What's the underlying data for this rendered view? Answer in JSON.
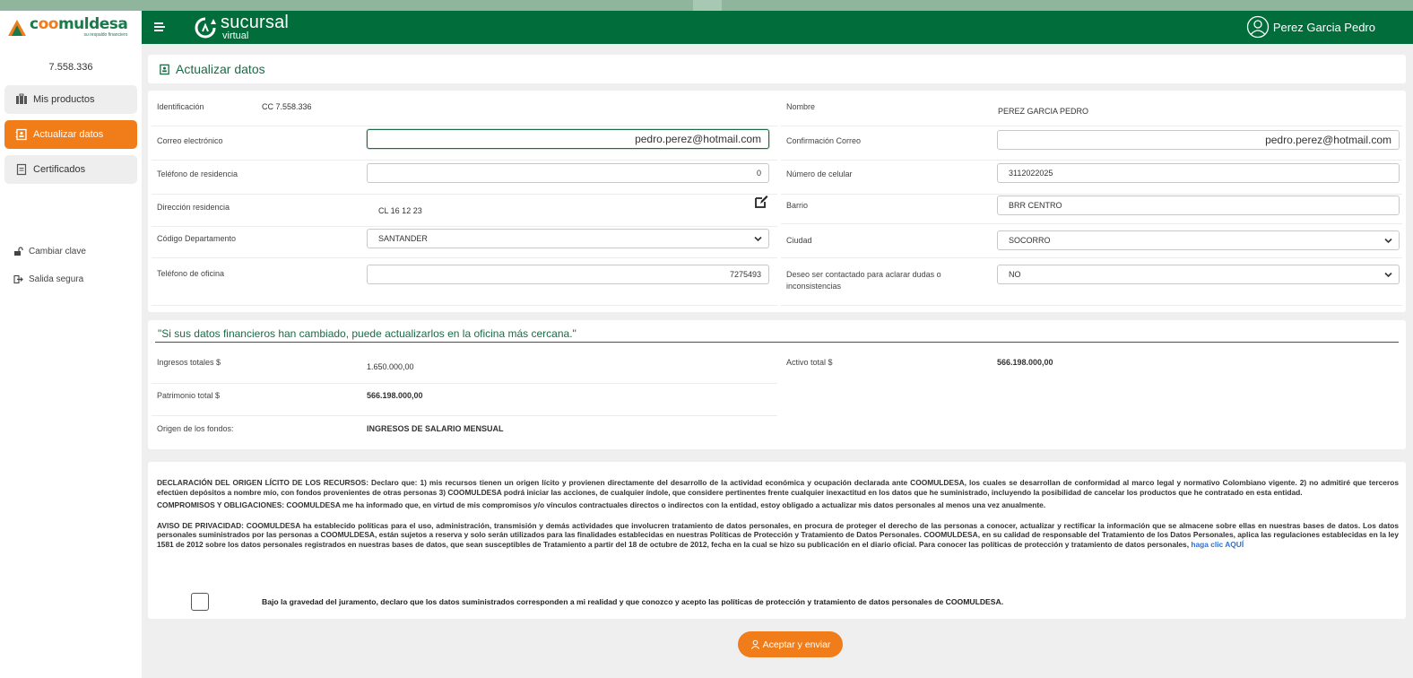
{
  "app": {
    "logo_name_a": "c",
    "logo_name_o": "oo",
    "logo_name_b": "muldesa",
    "logo_tagline": "su respaldo financiero",
    "brand_main": "sucursal",
    "brand_sub": "virtual",
    "user_name": "Perez Garcia Pedro"
  },
  "sidebar": {
    "id_number": "7.558.336",
    "items": [
      {
        "label": "Mis productos",
        "icon": "briefcase-icon"
      },
      {
        "label": "Actualizar datos",
        "icon": "contact-card-icon"
      },
      {
        "label": "Certificados",
        "icon": "document-icon"
      }
    ],
    "links": [
      {
        "label": "Cambiar clave",
        "icon": "unlock-icon"
      },
      {
        "label": "Salida segura",
        "icon": "logout-icon"
      }
    ]
  },
  "page": {
    "title": "Actualizar datos"
  },
  "form": {
    "identificacion_label": "Identificación",
    "identificacion_value": "CC 7.558.336",
    "nombre_label": "Nombre",
    "nombre_value": "PEREZ GARCIA PEDRO",
    "correo_label": "Correo electrónico",
    "correo_value": "pedro.perez@hotmail.com",
    "confirm_correo_label": "Confirmación Correo",
    "confirm_correo_value": "pedro.perez@hotmail.com",
    "tel_residencia_label": "Teléfono de residencia",
    "tel_residencia_value": "0",
    "celular_label": "Número de celular",
    "celular_value": "3112022025",
    "direccion_label": "Dirección residencia",
    "direccion_value": "CL 16 12 23",
    "barrio_label": "Barrio",
    "barrio_value": "BRR CENTRO",
    "departamento_label": "Código Departamento",
    "departamento_value": "SANTANDER",
    "ciudad_label": "Ciudad",
    "ciudad_value": "SOCORRO",
    "tel_oficina_label": "Teléfono de oficina",
    "tel_oficina_value": "7275493",
    "contacto_label_1": "Deseo ser contactado para aclarar dudas o",
    "contacto_label_2": "inconsistencias",
    "contacto_value": "NO"
  },
  "financial": {
    "quote": "\"Si sus datos financieros han cambiado, puede actualizarlos en la oficina más cercana.\"",
    "ingresos_label": "Ingresos totales $",
    "ingresos_value": "1.650.000,00",
    "activo_label": "Activo total $",
    "activo_value": "566.198.000,00",
    "patrimonio_label": "Patrimonio total $",
    "patrimonio_value": "566.198.000,00",
    "origen_label": "Origen de los fondos:",
    "origen_value": "INGRESOS DE SALARIO MENSUAL"
  },
  "declaration": {
    "p1_title": "DECLARACIÓN DEL ORIGEN LÍCITO DE LOS RECURSOS:",
    "p1_body": " Declaro que: 1) mis recursos tienen un origen lícito y provienen directamente del desarrollo de la actividad económica y ocupación declarada ante COOMULDESA, los cuales se desarrollan de conformidad al marco legal y normativo Colombiano vigente. 2) no admitiré que terceros efectúen depósitos a nombre mío, con fondos provenientes de otras personas 3) COOMULDESA podrá iniciar las acciones, de cualquier índole, que considere pertinentes frente cualquier inexactitud en los datos que he suministrado, incluyendo la posibilidad de cancelar los productos que he contratado en esta entidad.",
    "p2_title": "COMPROMISOS Y OBLIGACIONES:",
    "p2_body": " COOMULDESA me ha informado que, en virtud de mis compromisos y/o vínculos contractuales directos o indirectos con la entidad, estoy obligado a actualizar mis datos personales al menos una vez anualmente.",
    "p3_title": "AVISO DE PRIVACIDAD:",
    "p3_body": " COOMULDESA ha establecido políticas para el uso, administración, transmisión y demás actividades que involucren tratamiento de datos personales, en procura de proteger el derecho de las personas a conocer, actualizar y rectificar la información que se almacene sobre ellas en nuestras bases de datos. Los datos personales suministrados por las personas a COOMULDESA, están sujetos a reserva y solo serán utilizados para las finalidades establecidas en nuestras Políticas de Protección y Tratamiento de Datos Personales. COOMULDESA, en su calidad de responsable del Tratamiento de los Datos Personales, aplica las regulaciones establecidas en la ley 1581 de 2012 sobre los datos personales registrados en nuestras bases de datos, que sean susceptibles de Tratamiento a partir del 18 de octubre de 2012, fecha en la cual se hizo su publicación en el diario oficial. Para conocer las políticas de protección y tratamiento de datos personales, ",
    "p3_link": "haga clic AQUÍ",
    "oath": "Bajo la gravedad del juramento, declaro que los datos suministrados corresponden a mi realidad y que conozco y acepto las políticas de protección y tratamiento de datos personales de COOMULDESA."
  },
  "actions": {
    "submit_label": "Aceptar y enviar"
  },
  "colors": {
    "brand_green": "#006d3b",
    "accent_orange": "#f07d1a",
    "text_green": "#1b6b45",
    "link_blue": "#2e6fd1"
  }
}
